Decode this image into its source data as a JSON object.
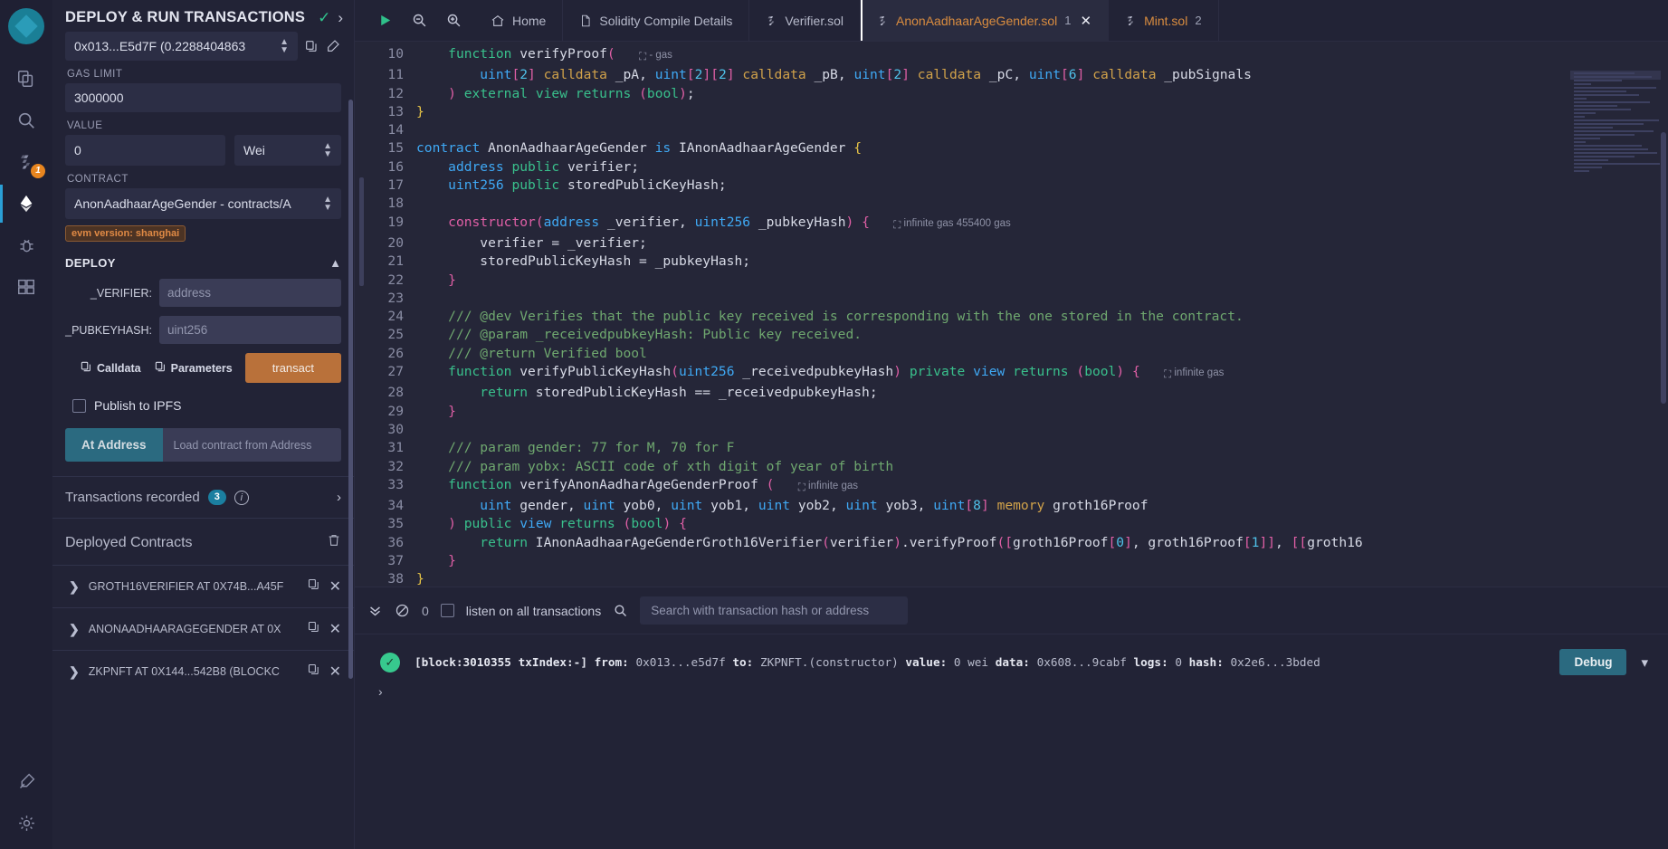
{
  "iconbar": {
    "logo_name": "remix-logo",
    "items": [
      {
        "name": "file-explorer-icon",
        "label": "File explorer"
      },
      {
        "name": "search-icon",
        "label": "Search in files"
      },
      {
        "name": "solidity-compiler-icon",
        "label": "Solidity compiler",
        "badge": "1"
      },
      {
        "name": "deploy-run-icon",
        "label": "Deploy & run transactions",
        "active": true
      },
      {
        "name": "debugger-icon",
        "label": "Debugger"
      },
      {
        "name": "plugin-manager-icon",
        "label": "Plugin manager"
      }
    ],
    "bottom_items": [
      {
        "name": "settings-plugin-icon",
        "label": "Plugin settings"
      },
      {
        "name": "gear-icon",
        "label": "Settings"
      }
    ]
  },
  "panel": {
    "title": "DEPLOY & RUN TRANSACTIONS",
    "status_check": "✓",
    "expand_arrow": "›",
    "account": {
      "value": "0x013...E5d7F (0.2288404863",
      "copy_icon": "copy-icon",
      "edit_icon": "edit-icon"
    },
    "gas_limit": {
      "label": "GAS LIMIT",
      "value": "3000000"
    },
    "value_field": {
      "label": "VALUE",
      "value": "0",
      "unit": "Wei"
    },
    "contract": {
      "label": "CONTRACT",
      "value": "AnonAadhaarAgeGender - contracts/A"
    },
    "evm_version": "evm version: shanghai",
    "deploy": {
      "title": "DEPLOY",
      "collapse_icon": "chevron-up-icon",
      "params": [
        {
          "label": "_VERIFIER:",
          "placeholder": "address",
          "value": ""
        },
        {
          "label": "_PUBKEYHASH:",
          "placeholder": "uint256",
          "value": ""
        }
      ],
      "calldata_label": "Calldata",
      "parameters_label": "Parameters",
      "transact_label": "transact"
    },
    "publish_ipfs": {
      "label": "Publish to IPFS",
      "checked": false
    },
    "at_address": {
      "button": "At Address",
      "placeholder": "Load contract from Address",
      "value": ""
    },
    "transactions_recorded": {
      "label": "Transactions recorded",
      "count": "3",
      "info_icon": "info-icon",
      "arrow": "›"
    },
    "deployed_contracts": {
      "title": "Deployed Contracts",
      "trash_icon": "trash-icon",
      "items": [
        {
          "name": "GROTH16VERIFIER AT 0X74B...A45F",
          "chev": "❯"
        },
        {
          "name": "ANONAADHAARAGEGENDER AT 0X",
          "chev": "❯"
        },
        {
          "name": "ZKPNFT AT 0X144...542B8 (BLOCKC",
          "chev": "❯"
        }
      ]
    }
  },
  "tabbar": {
    "tools": [
      {
        "name": "run-icon",
        "glyph": "▶"
      },
      {
        "name": "zoom-out-icon",
        "glyph": "zoom-out"
      },
      {
        "name": "zoom-in-icon",
        "glyph": "zoom-in"
      }
    ],
    "tabs": [
      {
        "label": "Home",
        "icon": "home-icon",
        "active": false,
        "num": "",
        "closable": false
      },
      {
        "label": "Solidity Compile Details",
        "icon": "file-icon",
        "active": false,
        "num": "",
        "closable": false
      },
      {
        "label": "Verifier.sol",
        "icon": "solidity-icon",
        "active": false,
        "num": "",
        "closable": false
      },
      {
        "label": "AnonAadhaarAgeGender.sol",
        "icon": "solidity-icon",
        "active": true,
        "num": "1",
        "closable": true
      },
      {
        "label": "Mint.sol",
        "icon": "solidity-icon",
        "active": false,
        "num": "2",
        "closable": false
      }
    ],
    "close_glyph": "✕"
  },
  "editor": {
    "first_line": 10,
    "lines": [
      {
        "n": 10,
        "html": "    <span class='kw2'>function</span> <span class='fn'>verifyProof</span><span class='punct-p'>(</span>",
        "gas": "- gas"
      },
      {
        "n": 11,
        "html": "        <span class='kw'>uint</span><span class='punct-p'>[</span><span class='num'>2</span><span class='punct-p'>]</span> <span class='mem'>calldata</span> _pA<span class='fn'>,</span> <span class='kw'>uint</span><span class='punct-p'>[</span><span class='num'>2</span><span class='punct-p'>][</span><span class='num'>2</span><span class='punct-p'>]</span> <span class='mem'>calldata</span> _pB<span class='fn'>,</span> <span class='kw'>uint</span><span class='punct-p'>[</span><span class='num'>2</span><span class='punct-p'>]</span> <span class='mem'>calldata</span> _pC<span class='fn'>,</span> <span class='kw'>uint</span><span class='punct-p'>[</span><span class='num'>6</span><span class='punct-p'>]</span> <span class='mem'>calldata</span> _pubSignals",
        "gas": ""
      },
      {
        "n": 12,
        "html": "    <span class='punct-p'>)</span> <span class='kw2'>external</span> <span class='kw2'>view</span> <span class='kw2'>returns</span> <span class='punct-p'>(</span><span class='kw2'>bool</span><span class='punct-p'>)</span>;",
        "gas": ""
      },
      {
        "n": 13,
        "html": "<span class='brc'>}</span>",
        "gas": ""
      },
      {
        "n": 14,
        "html": "",
        "gas": ""
      },
      {
        "n": 15,
        "html": "<span class='kw'>contract</span> AnonAadhaarAgeGender <span class='kw'>is</span> IAnonAadhaarAgeGender <span class='brc'>{</span>",
        "gas": ""
      },
      {
        "n": 16,
        "html": "    <span class='kw'>address</span> <span class='kw2'>public</span> verifier;",
        "gas": ""
      },
      {
        "n": 17,
        "html": "    <span class='kw'>uint256</span> <span class='kw2'>public</span> storedPublicKeyHash;",
        "gas": ""
      },
      {
        "n": 18,
        "html": "",
        "gas": ""
      },
      {
        "n": 19,
        "html": "    <span class='punct-p'>constructor</span><span class='punct-p'>(</span><span class='kw'>address</span> _verifier, <span class='kw'>uint256</span> _pubkeyHash<span class='punct-p'>)</span> <span class='punct-p'>{</span>",
        "gas": "infinite gas 455400 gas"
      },
      {
        "n": 20,
        "html": "        verifier = _verifier;",
        "gas": ""
      },
      {
        "n": 21,
        "html": "        storedPublicKeyHash = _pubkeyHash;",
        "gas": ""
      },
      {
        "n": 22,
        "html": "    <span class='punct-p'>}</span>",
        "gas": ""
      },
      {
        "n": 23,
        "html": "",
        "gas": ""
      },
      {
        "n": 24,
        "html": "    <span class='com'>/// @dev Verifies that the public key received is corresponding with the one stored in the contract.</span>",
        "gas": ""
      },
      {
        "n": 25,
        "html": "    <span class='com'>/// @param _receivedpubkeyHash: Public key received.</span>",
        "gas": ""
      },
      {
        "n": 26,
        "html": "    <span class='com'>/// @return Verified bool</span>",
        "gas": ""
      },
      {
        "n": 27,
        "html": "    <span class='kw2'>function</span> verifyPublicKeyHash<span class='punct-p'>(</span><span class='kw'>uint256</span> _receivedpubkeyHash<span class='punct-p'>)</span> <span class='kw2'>private</span> <span class='kw'>view</span> <span class='kw2'>returns</span> <span class='punct-p'>(</span><span class='kw2'>bool</span><span class='punct-p'>)</span> <span class='punct-p'>{</span>",
        "gas": "infinite gas"
      },
      {
        "n": 28,
        "html": "        <span class='kw2'>return</span> storedPublicKeyHash == _receivedpubkeyHash;",
        "gas": ""
      },
      {
        "n": 29,
        "html": "    <span class='punct-p'>}</span>",
        "gas": ""
      },
      {
        "n": 30,
        "html": "",
        "gas": ""
      },
      {
        "n": 31,
        "html": "    <span class='com'>/// param gender: 77 for M, 70 for F</span>",
        "gas": ""
      },
      {
        "n": 32,
        "html": "    <span class='com'>/// param yobx: ASCII code of xth digit of year of birth</span>",
        "gas": ""
      },
      {
        "n": 33,
        "html": "    <span class='kw2'>function</span> verifyAnonAadharAgeGenderProof <span class='punct-p'>(</span>",
        "gas": "infinite gas"
      },
      {
        "n": 34,
        "html": "        <span class='kw'>uint</span> gender, <span class='kw'>uint</span> yob0, <span class='kw'>uint</span> yob1, <span class='kw'>uint</span> yob2, <span class='kw'>uint</span> yob3, <span class='kw'>uint</span><span class='punct-p'>[</span><span class='num'>8</span><span class='punct-p'>]</span> <span class='mem'>memory</span> groth16Proof",
        "gas": ""
      },
      {
        "n": 35,
        "html": "    <span class='punct-p'>)</span> <span class='kw2'>public</span> <span class='kw'>view</span> <span class='kw2'>returns</span> <span class='punct-p'>(</span><span class='kw2'>bool</span><span class='punct-p'>)</span> <span class='punct-p'>{</span>",
        "gas": ""
      },
      {
        "n": 36,
        "html": "        <span class='kw2'>return</span> IAnonAadhaarAgeGenderGroth16Verifier<span class='punct-p'>(</span>verifier<span class='punct-p'>)</span>.verifyProof<span class='punct-p'>(</span><span class='punct-p'>[</span>groth16Proof<span class='punct-p'>[</span><span class='num'>0</span><span class='punct-p'>]</span>, groth16Proof<span class='punct-p'>[</span><span class='num'>1</span><span class='punct-p'>]]</span>, <span class='punct-p'>[[</span>groth16",
        "gas": ""
      },
      {
        "n": 37,
        "html": "    <span class='punct-p'>}</span>",
        "gas": ""
      },
      {
        "n": 38,
        "html": "<span class='brc'>}</span>",
        "gas": ""
      },
      {
        "n": 39,
        "html": "",
        "gas": ""
      }
    ]
  },
  "terminal": {
    "collapse_icon": "double-chevron-down-icon",
    "clear_icon": "ban-icon",
    "pending_count": "0",
    "listen_label": "listen on all transactions",
    "listen_checked": false,
    "search_icon": "search-icon",
    "search_placeholder": "Search with transaction hash or address",
    "search_value": "",
    "log": {
      "status_icon": "success-check-icon",
      "block_label": "[block:3010355 txIndex:-]",
      "from_key": "from:",
      "from_val": "0x013...e5d7f",
      "to_key": "to:",
      "to_val": "ZKPNFT.(constructor)",
      "value_key": "value:",
      "value_val": "0 wei",
      "data_key": "data:",
      "data_val": "0x608...9cabf",
      "logs_key": "logs:",
      "logs_val": "0",
      "hash_key": "hash:",
      "hash_val": "0x2e6...3bded",
      "debug_label": "Debug",
      "expand_icon": "chevron-down-icon"
    },
    "prompt": "›"
  },
  "colors": {
    "accent_orange": "#d98c3f",
    "accent_teal": "#2b6a80",
    "success_green": "#37c98e",
    "bg_dark": "#222336",
    "bg_editor": "#252638"
  }
}
